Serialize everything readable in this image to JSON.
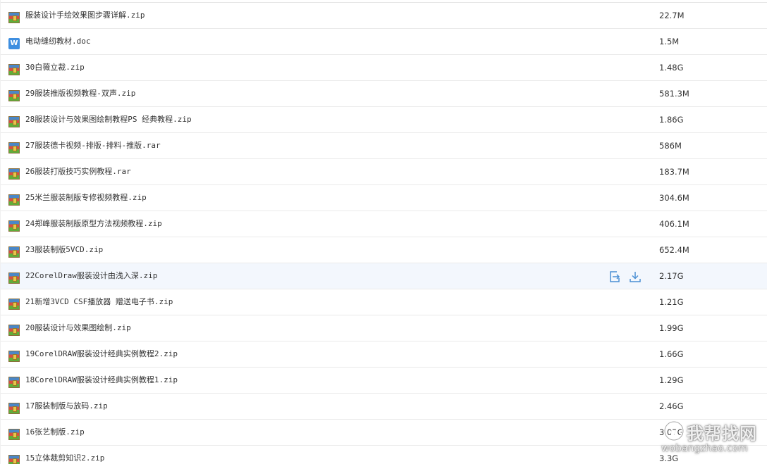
{
  "files": [
    {
      "name": "服装设计手绘效果图步骤详解.zip",
      "size": "22.7M",
      "icon": "archive-icon"
    },
    {
      "name": "电动缝纫教材.doc",
      "size": "1.5M",
      "icon": "word-doc-icon"
    },
    {
      "name": "30白薇立裁.zip",
      "size": "1.48G",
      "icon": "archive-icon"
    },
    {
      "name": "29服装推版视频教程-双声.zip",
      "size": "581.3M",
      "icon": "archive-icon"
    },
    {
      "name": "28服装设计与效果图绘制教程PS 经典教程.zip",
      "size": "1.86G",
      "icon": "archive-icon"
    },
    {
      "name": "27服装德卡视频-排版-排料-推版.rar",
      "size": "586M",
      "icon": "archive-icon"
    },
    {
      "name": "26服装打版技巧实例教程.rar",
      "size": "183.7M",
      "icon": "archive-icon"
    },
    {
      "name": "25米兰服装制版专修视频教程.zip",
      "size": "304.6M",
      "icon": "archive-icon"
    },
    {
      "name": "24郑峰服装制版原型方法视频教程.zip",
      "size": "406.1M",
      "icon": "archive-icon"
    },
    {
      "name": "23服装制版5VCD.zip",
      "size": "652.4M",
      "icon": "archive-icon"
    },
    {
      "name": "22CorelDraw服装设计由浅入深.zip",
      "size": "2.17G",
      "icon": "archive-icon"
    },
    {
      "name": "21新增3VCD CSF播放器 赠送电子书.zip",
      "size": "1.21G",
      "icon": "archive-icon"
    },
    {
      "name": "20服装设计与效果图绘制.zip",
      "size": "1.99G",
      "icon": "archive-icon"
    },
    {
      "name": "19CorelDRAW服装设计经典实例教程2.zip",
      "size": "1.66G",
      "icon": "archive-icon"
    },
    {
      "name": "18CorelDRAW服装设计经典实例教程1.zip",
      "size": "1.29G",
      "icon": "archive-icon"
    },
    {
      "name": "17服装制版与放码.zip",
      "size": "2.46G",
      "icon": "archive-icon"
    },
    {
      "name": "16张艺制版.zip",
      "size": "3.07G",
      "icon": "archive-icon"
    },
    {
      "name": "15立体裁剪知识2.zip",
      "size": "3.3G",
      "icon": "archive-icon"
    }
  ],
  "hover_row_index": 10,
  "row_actions": {
    "share_icon": "share-icon",
    "download_icon": "download-icon"
  },
  "watermark": {
    "title": "我帮找网",
    "subtitle": "wobangzhao.com"
  },
  "colors": {
    "hover_row": "#f3f7fd",
    "border": "#eaeaea",
    "text": "#333333",
    "action_icon": "#4a8fd4",
    "word_icon": "#3f8fe0"
  }
}
